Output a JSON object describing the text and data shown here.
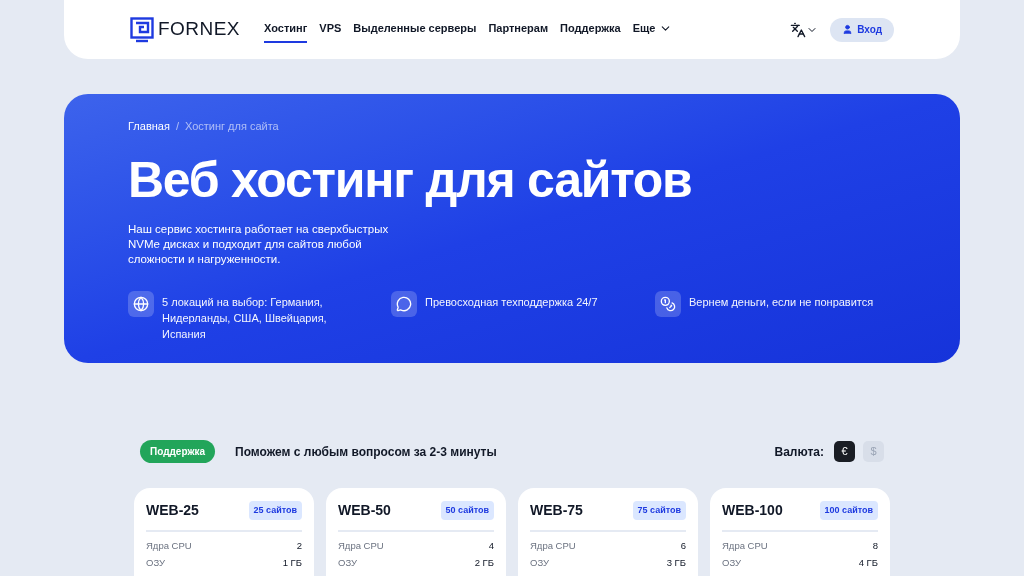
{
  "header": {
    "logo": "FORNEX",
    "nav": [
      {
        "label": "Хостинг",
        "selected": true
      },
      {
        "label": "VPS",
        "selected": false
      },
      {
        "label": "Выделенные серверы",
        "selected": false
      },
      {
        "label": "Партнерам",
        "selected": false
      },
      {
        "label": "Поддержка",
        "selected": false
      },
      {
        "label": "Еще",
        "selected": false,
        "kind": "dropdown"
      }
    ],
    "login": "Вход"
  },
  "hero": {
    "breadcrumbs": [
      "Главная",
      "Хостинг для сайта"
    ],
    "breadcrumb_separator": "/",
    "title": "Веб хостинг для сайтов",
    "description": "Наш сервис хостинга работает на сверхбыстрых NVMe дисках и подходит для сайтов любой сложности и нагруженности.",
    "features": [
      {
        "kind": "globe",
        "text": "5 локаций на выбор: Германия, Нидерланды, США, Швейцария, Испания"
      },
      {
        "kind": "chat",
        "text": "Превосходная техподдержка 24/7"
      },
      {
        "kind": "coins",
        "text": "Вернем деньги, если не понравится"
      }
    ]
  },
  "support": {
    "badge": "Поддержка",
    "text": "Поможем с любым вопросом за 2-3 минуты"
  },
  "currency": {
    "label": "Валюта:",
    "options": [
      {
        "symbol": "€",
        "selected": true
      },
      {
        "symbol": "$",
        "selected": false
      }
    ]
  },
  "plans": [
    {
      "name": "WEB-25",
      "badge": "25 сайтов",
      "specs": [
        {
          "label": "Ядра CPU",
          "value": "2"
        },
        {
          "label": "ОЗУ",
          "value": "1 ГБ"
        }
      ]
    },
    {
      "name": "WEB-50",
      "badge": "50 сайтов",
      "specs": [
        {
          "label": "Ядра CPU",
          "value": "4"
        },
        {
          "label": "ОЗУ",
          "value": "2 ГБ"
        }
      ]
    },
    {
      "name": "WEB-75",
      "badge": "75 сайтов",
      "specs": [
        {
          "label": "Ядра CPU",
          "value": "6"
        },
        {
          "label": "ОЗУ",
          "value": "3 ГБ"
        }
      ]
    },
    {
      "name": "WEB-100",
      "badge": "100 сайтов",
      "specs": [
        {
          "label": "Ядра CPU",
          "value": "8"
        },
        {
          "label": "ОЗУ",
          "value": "4 ГБ"
        }
      ]
    }
  ]
}
